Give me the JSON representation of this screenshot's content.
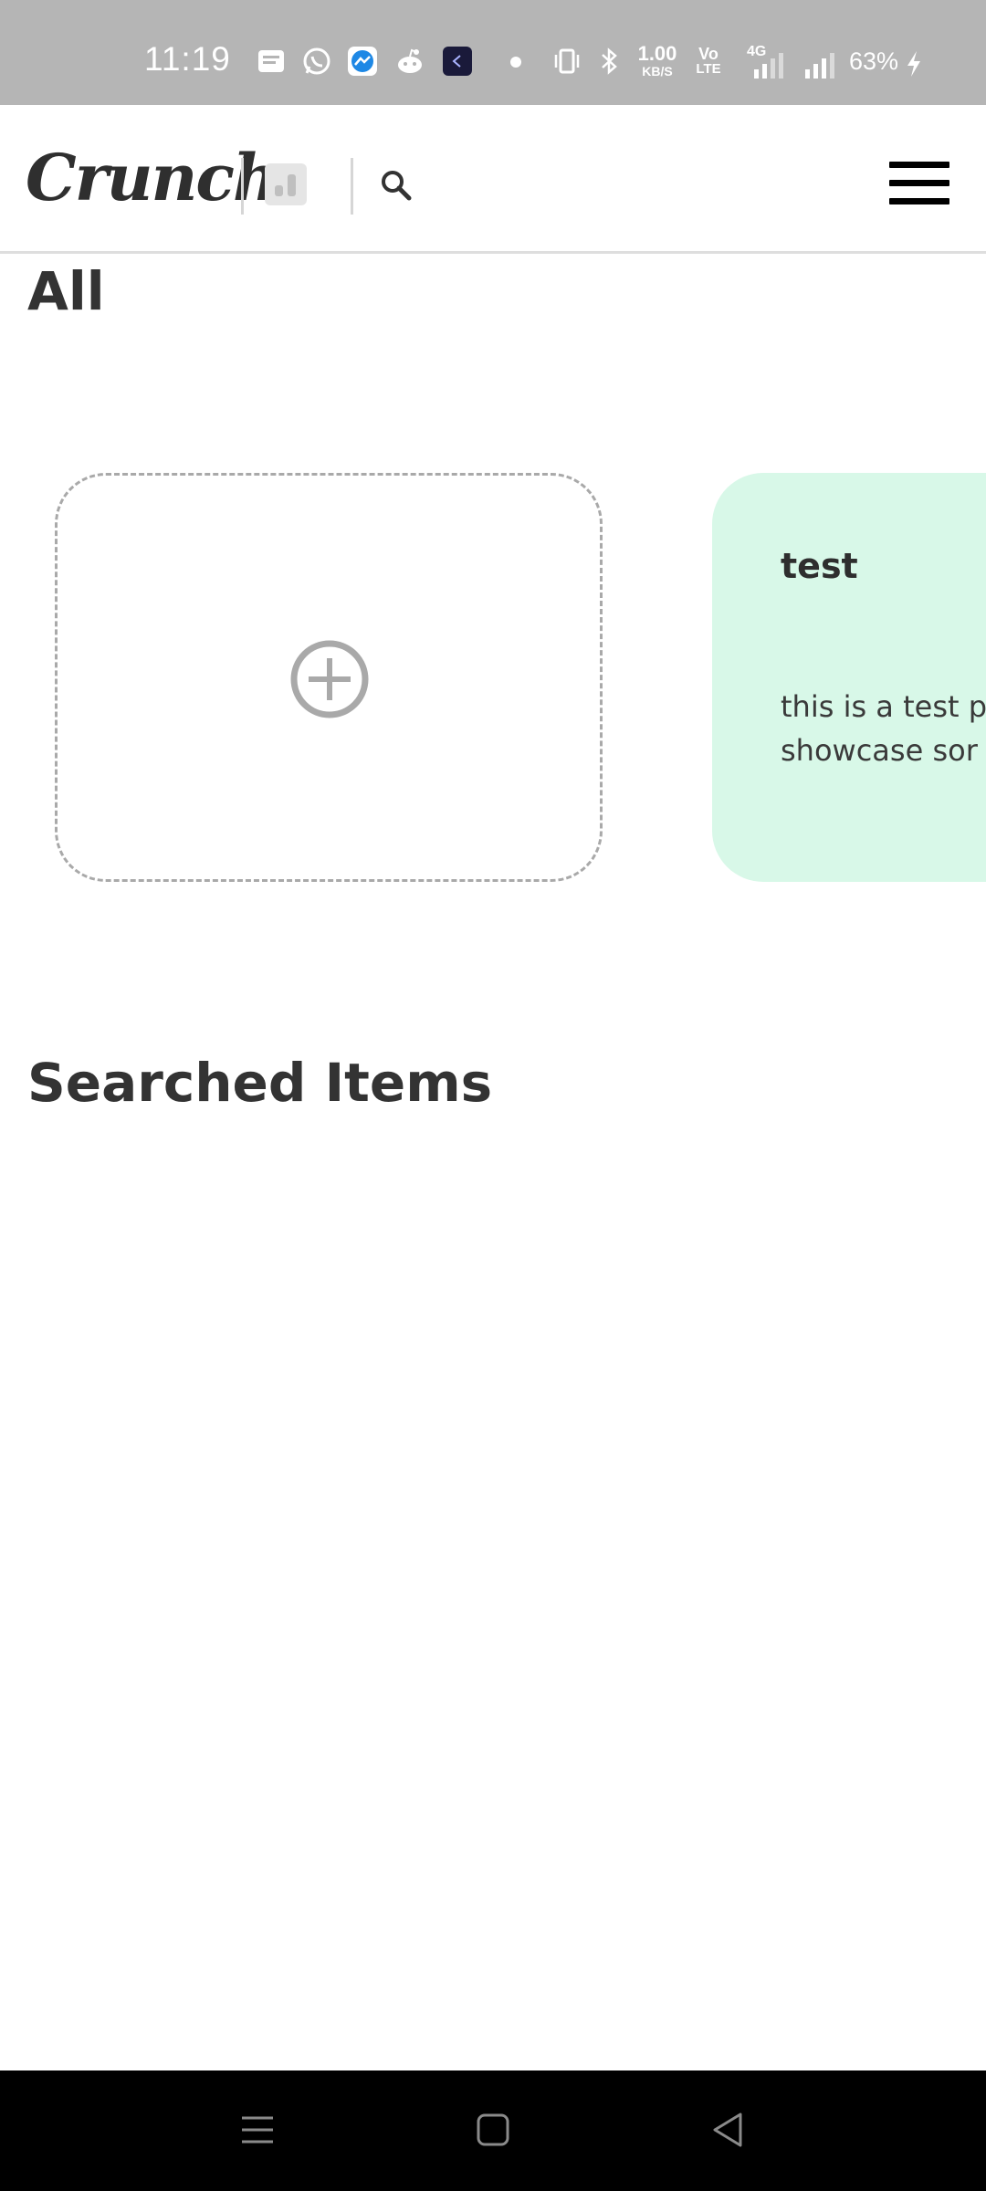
{
  "status_bar": {
    "time": "11:19",
    "speed_value": "1.00",
    "speed_unit": "KB/S",
    "volte_top": "Vo",
    "volte_bottom": "LTE",
    "network": "4G",
    "battery": "63%",
    "icons": [
      "message-icon",
      "whatsapp-icon",
      "messenger-icon",
      "reddit-icon",
      "app-icon",
      "dot-icon",
      "vibrate-icon",
      "bluetooth-icon",
      "signal-icon",
      "charging-icon"
    ],
    "background_color": "#b5b5b5"
  },
  "header": {
    "logo": "Crunch",
    "icons": [
      "chart-icon",
      "search-icon",
      "hamburger-menu-icon"
    ]
  },
  "sections": {
    "all_title": "All",
    "searched_title": "Searched Items"
  },
  "cards": {
    "add_icon": "plus-circle-icon",
    "note": {
      "title": "test",
      "body_line1": "this is a test p",
      "body_line2": "showcase sor",
      "background_color": "#d8f8e8"
    }
  },
  "navigation_bar": {
    "icons": [
      "recents-icon",
      "home-icon",
      "back-icon"
    ]
  }
}
